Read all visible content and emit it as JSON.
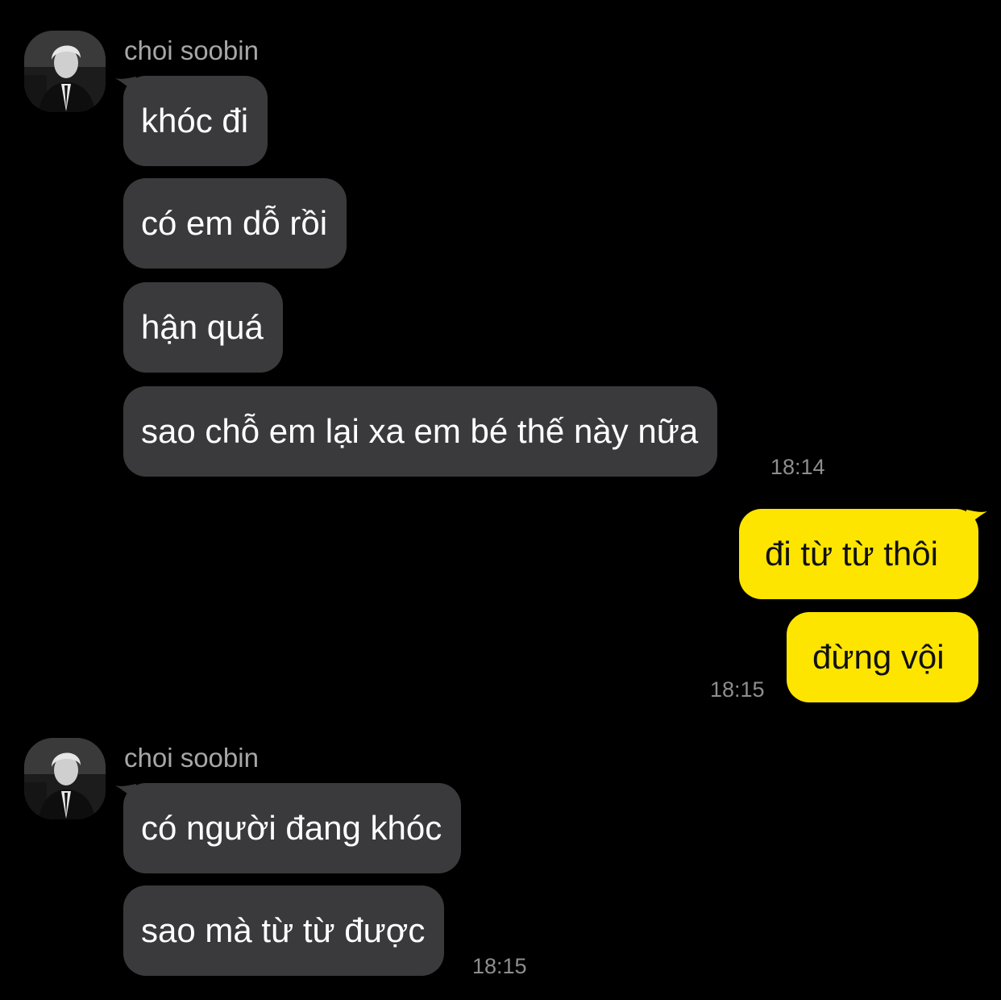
{
  "colors": {
    "background": "#000000",
    "incoming_bubble": "#3a3a3c",
    "outgoing_bubble": "#fee500",
    "timestamp": "#8e8e8e",
    "sender_name": "#a7a7a7"
  },
  "groups": [
    {
      "direction": "incoming",
      "sender_name": "choi soobin",
      "avatar_icon": "profile-photo-avatar",
      "messages": [
        "khóc đi",
        "có em dỗ rồi",
        "hận quá",
        "sao chỗ em lại xa em bé thế này nữa"
      ],
      "time": "18:14"
    },
    {
      "direction": "outgoing",
      "messages": [
        "đi từ từ thôi",
        "đừng vội"
      ],
      "time": "18:15"
    },
    {
      "direction": "incoming",
      "sender_name": "choi soobin",
      "avatar_icon": "profile-photo-avatar",
      "messages": [
        "có người đang khóc",
        "sao mà từ từ được"
      ],
      "time": "18:15"
    }
  ]
}
